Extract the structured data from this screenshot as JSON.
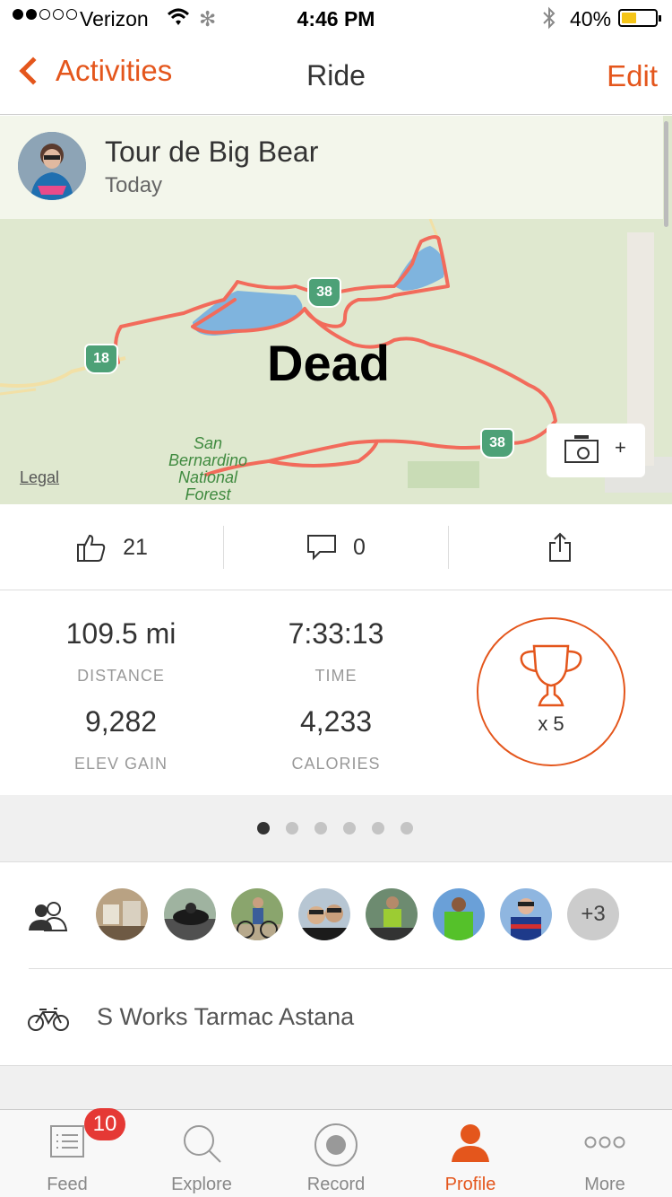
{
  "status_bar": {
    "carrier": "Verizon",
    "time": "4:46 PM",
    "battery": "40%"
  },
  "nav": {
    "back_label": "Activities",
    "title": "Ride",
    "edit_label": "Edit"
  },
  "activity": {
    "name": "Tour de Big Bear",
    "date": "Today"
  },
  "map": {
    "overlay_text": "Dead",
    "legal": "Legal",
    "forest_label": "San Bernardino National Forest",
    "highway_shields": [
      "18",
      "38",
      "38"
    ],
    "photo_plus": "+",
    "route_color": "#f26b5b"
  },
  "actions": {
    "kudos_count": "21",
    "comments_count": "0"
  },
  "stats": {
    "distance_value": "109.5 mi",
    "distance_label": "DISTANCE",
    "time_value": "7:33:13",
    "time_label": "TIME",
    "elev_value": "9,282",
    "elev_label": "ELEV GAIN",
    "calories_value": "4,233",
    "calories_label": "CALORIES",
    "achievements": "x 5"
  },
  "pager": {
    "page_count": 6,
    "active_index": 0
  },
  "athletes": {
    "more_label": "+3"
  },
  "gear": {
    "bike_name": "S Works Tarmac Astana"
  },
  "tabs": [
    {
      "label": "Feed",
      "badge": "10"
    },
    {
      "label": "Explore"
    },
    {
      "label": "Record"
    },
    {
      "label": "Profile"
    },
    {
      "label": "More"
    }
  ],
  "colors": {
    "accent": "#e4561c",
    "badge": "#e53935"
  }
}
